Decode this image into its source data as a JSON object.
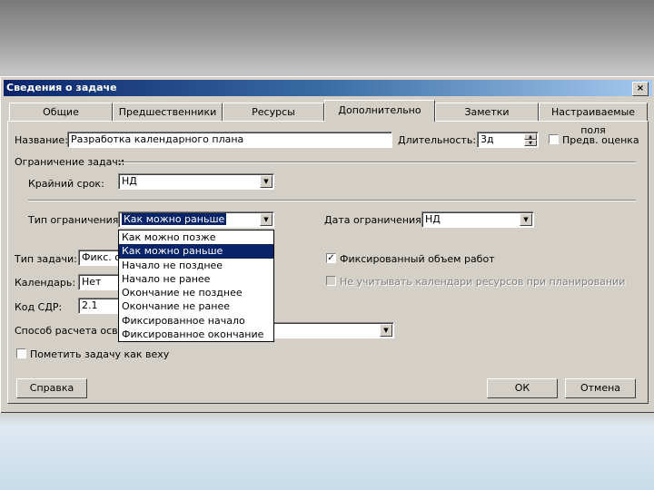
{
  "window": {
    "title": "Сведения о задаче",
    "close_label": "×"
  },
  "tabs": [
    {
      "label": "Общие"
    },
    {
      "label": "Предшественники"
    },
    {
      "label": "Ресурсы"
    },
    {
      "label": "Дополнительно"
    },
    {
      "label": "Заметки"
    },
    {
      "label": "Настраиваемые поля"
    }
  ],
  "fields": {
    "name_label": "Название:",
    "name_value": "Разработка календарного плана",
    "duration_label": "Длительность:",
    "duration_value": "3д",
    "estimate_label": "Предв. оценка",
    "constraint_group_label": "Ограничение задачи",
    "deadline_label": "Крайний срок:",
    "deadline_value": "НД",
    "constraint_type_label": "Тип ограничения:",
    "constraint_type_value": "Как можно раньше",
    "constraint_date_label": "Дата ограничения:",
    "constraint_date_value": "НД",
    "task_type_label": "Тип задачи:",
    "task_type_value": "Фикс. об",
    "calendar_label": "Календарь:",
    "calendar_value": "Нет",
    "wbs_label": "Код СДР:",
    "wbs_value": "2.1",
    "earned_value_label": "Способ расчета осво",
    "fixed_work_label": "Фиксированный объем работ",
    "ignore_calendars_label": "Не учитывать календари ресурсов при планировании",
    "milestone_label": "Пометить задачу как веху"
  },
  "dropdown_options": [
    "Как можно позже",
    "Как можно раньше",
    "Начало не позднее",
    "Начало не ранее",
    "Окончание не позднее",
    "Окончание не ранее",
    "Фиксированное начало",
    "Фиксированное окончание"
  ],
  "buttons": {
    "help": "Справка",
    "ok": "ОК",
    "cancel": "Отмена"
  },
  "checkbox_mark": "✓",
  "colors": {
    "title_bar": "#0a246a",
    "dialog_bg": "#d4d0c8",
    "highlight": "#0a246a"
  }
}
